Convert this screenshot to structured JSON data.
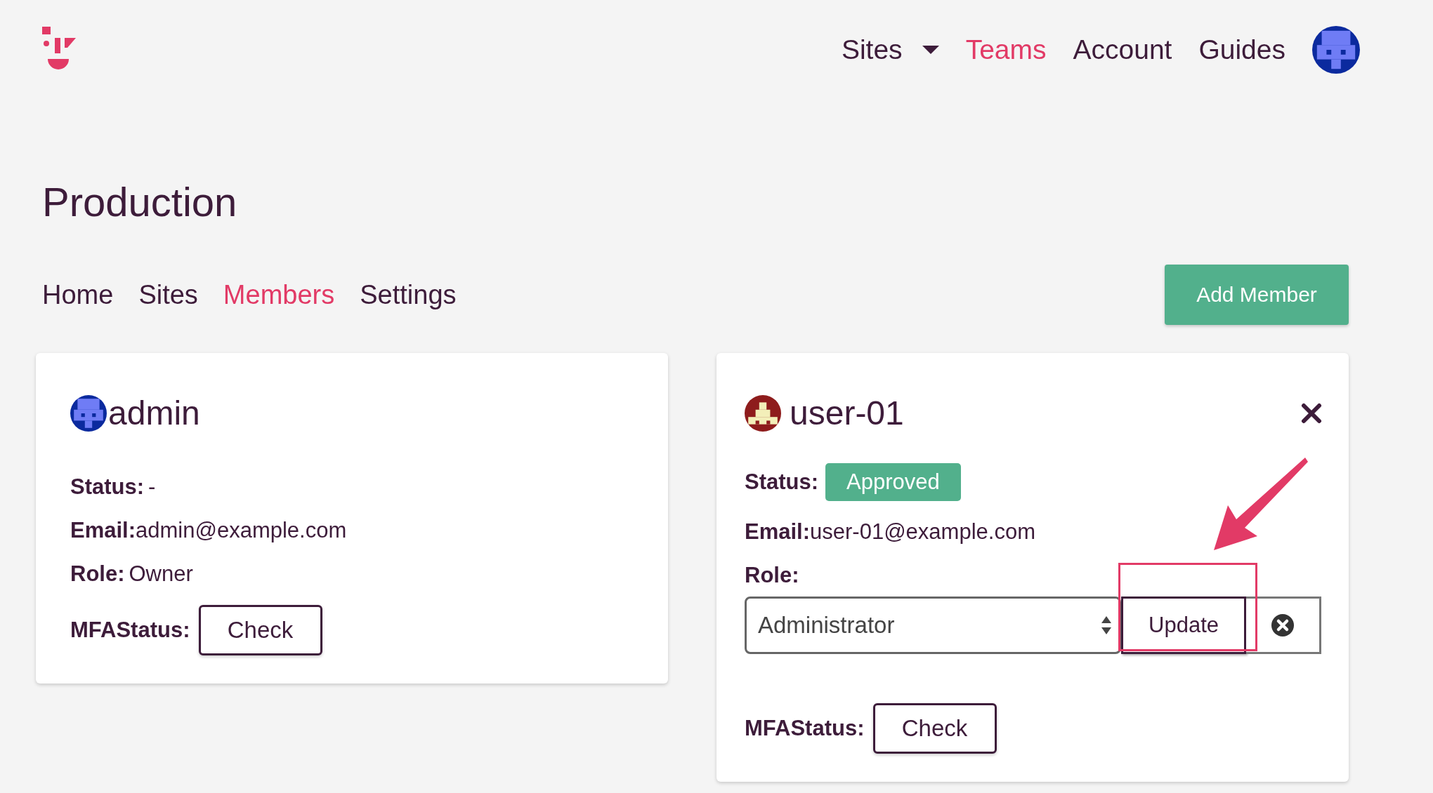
{
  "nav": {
    "items": [
      {
        "label": "Sites",
        "selected": false,
        "dropdown": true
      },
      {
        "label": "Teams",
        "selected": true,
        "dropdown": false
      },
      {
        "label": "Account",
        "selected": false,
        "dropdown": false
      },
      {
        "label": "Guides",
        "selected": false,
        "dropdown": false
      }
    ]
  },
  "page_title": "Production",
  "tabs": [
    {
      "label": "Home",
      "selected": false
    },
    {
      "label": "Sites",
      "selected": false
    },
    {
      "label": "Members",
      "selected": true
    },
    {
      "label": "Settings",
      "selected": false
    }
  ],
  "add_button": "Add Member",
  "members": [
    {
      "kind": "owner",
      "name": "admin",
      "color": "#0b2a9e",
      "removable": false,
      "status_label": "Status:",
      "status": "-",
      "email_label": "Email:",
      "email": "admin@example.com",
      "role_label": "Role:",
      "role": "Owner",
      "mfa_label": "MFAStatus:",
      "mfa_button": "Check"
    },
    {
      "kind": "editable",
      "name": "user-01",
      "color": "#8e1c1c",
      "removable": true,
      "status_label": "Status:",
      "status": "Approved",
      "email_label": "Email:",
      "email": "user-01@example.com",
      "role_label": "Role:",
      "role": "Administrator",
      "update_button": "Update",
      "mfa_label": "MFAStatus:",
      "mfa_button": "Check"
    }
  ]
}
